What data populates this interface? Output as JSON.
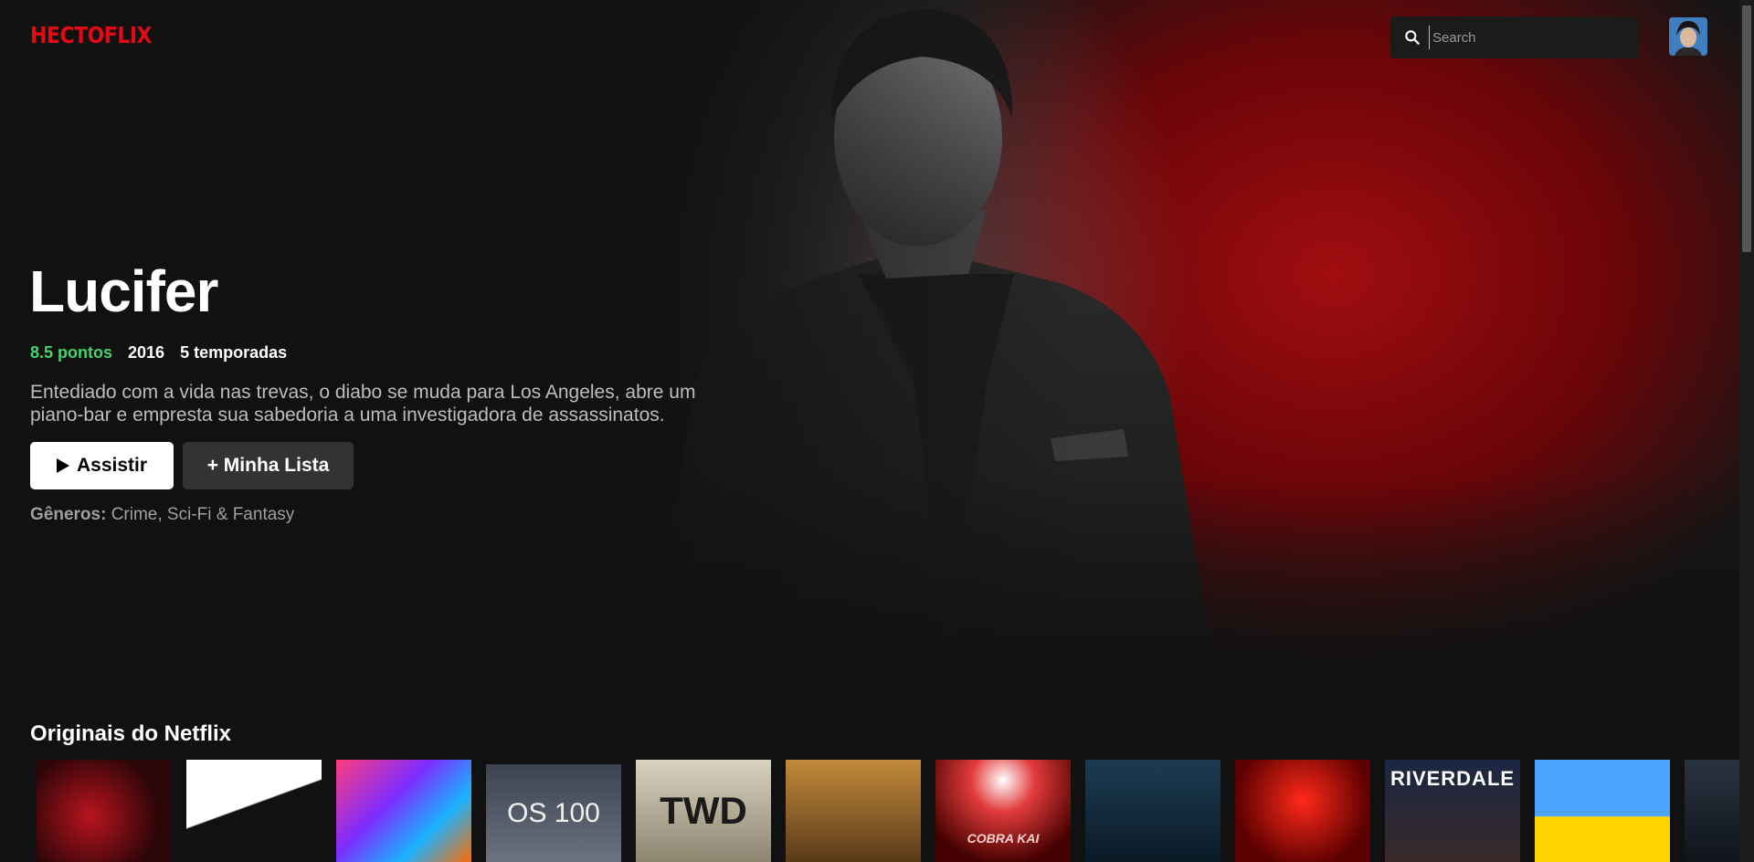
{
  "brand": {
    "logo": "HECTOFLIX",
    "accent": "#e50914"
  },
  "search": {
    "placeholder": "Search",
    "icon": "search-icon"
  },
  "profile": {
    "icon": "avatar"
  },
  "featured": {
    "title": "Lucifer",
    "points": "8.5 pontos",
    "year": "2016",
    "seasons": "5 temporadas",
    "description": "Entediado com a vida nas trevas, o diabo se muda para Los Angeles, abre um piano-bar e empresta sua sabedoria a uma investigadora de assassinatos.",
    "play_label": "Assistir",
    "list_label": "+ Minha Lista",
    "genres_label": "Gêneros:",
    "genres_value": " Crime, Sci-Fi & Fantasy"
  },
  "row": {
    "title": "Originais do Netflix",
    "posters": [
      {
        "label": ""
      },
      {
        "label": ""
      },
      {
        "label": ""
      },
      {
        "label": "OS 100"
      },
      {
        "label": "TWD"
      },
      {
        "label": ""
      },
      {
        "label": "COBRA KAI"
      },
      {
        "label": ""
      },
      {
        "label": ""
      },
      {
        "label": "RIVERDALE"
      },
      {
        "label": ""
      },
      {
        "label": ""
      }
    ]
  }
}
